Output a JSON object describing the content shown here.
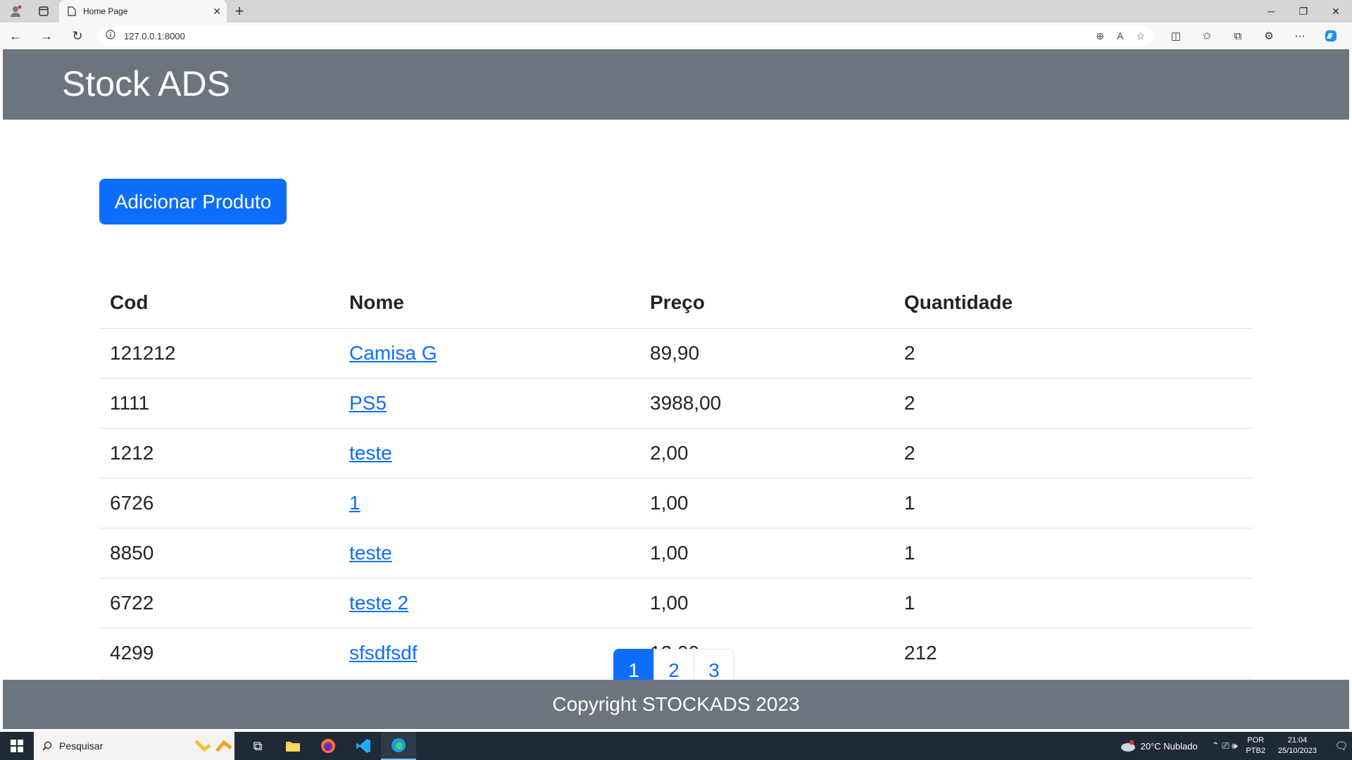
{
  "browser": {
    "tab_title": "Home Page",
    "tab_close": "✕",
    "new_tab": "+",
    "url": "127.0.0.1:8000"
  },
  "site": {
    "brand": "Stock ADS",
    "add_button": "Adicionar Produto",
    "table": {
      "headers": [
        "Cod",
        "Nome",
        "Preço",
        "Quantidade"
      ],
      "rows": [
        {
          "cod": "121212",
          "nome": "Camisa G",
          "preco": "89,90",
          "quantidade": "2"
        },
        {
          "cod": "1111",
          "nome": "PS5",
          "preco": "3988,00",
          "quantidade": "2"
        },
        {
          "cod": "1212",
          "nome": "teste",
          "preco": "2,00",
          "quantidade": "2"
        },
        {
          "cod": "6726",
          "nome": "1",
          "preco": "1,00",
          "quantidade": "1"
        },
        {
          "cod": "8850",
          "nome": "teste",
          "preco": "1,00",
          "quantidade": "1"
        },
        {
          "cod": "6722",
          "nome": "teste 2",
          "preco": "1,00",
          "quantidade": "1"
        },
        {
          "cod": "4299",
          "nome": "sfsdfsdf",
          "preco": "12,00",
          "quantidade": "212"
        }
      ]
    },
    "pagination": [
      "1",
      "2",
      "3"
    ],
    "footer": "Copyright STOCKADS 2023"
  },
  "taskbar": {
    "search_placeholder": "Pesquisar",
    "weather": "20°C  Nublado",
    "lang_top": "POR",
    "lang_bottom": "PTB2",
    "time": "21:04",
    "date": "25/10/2023"
  },
  "colors": {
    "header_bg": "#6c757d",
    "primary": "#0d6efd",
    "taskbar_bg": "#1f2a36"
  }
}
